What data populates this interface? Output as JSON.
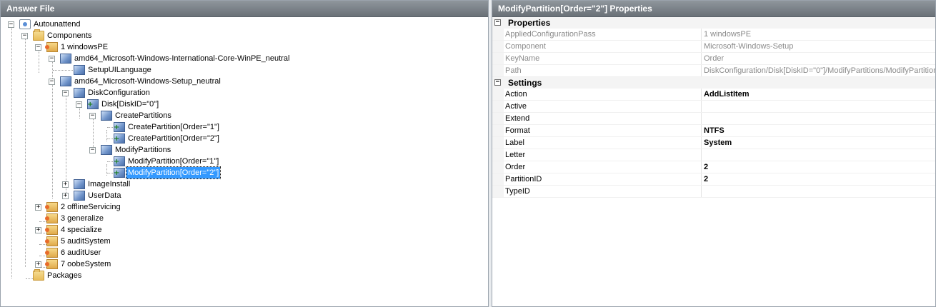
{
  "left_pane": {
    "title": "Answer File"
  },
  "right_pane": {
    "title": "ModifyPartition[Order=\"2\"] Properties"
  },
  "tree": {
    "root": "Autounattend",
    "components": "Components",
    "pass1": "1 windowsPE",
    "intl_component": "amd64_Microsoft-Windows-International-Core-WinPE_neutral",
    "setup_ui_language": "SetupUILanguage",
    "setup_component": "amd64_Microsoft-Windows-Setup_neutral",
    "disk_configuration": "DiskConfiguration",
    "disk": "Disk[DiskID=\"0\"]",
    "create_partitions": "CreatePartitions",
    "create_partition_1": "CreatePartition[Order=\"1\"]",
    "create_partition_2": "CreatePartition[Order=\"2\"]",
    "modify_partitions": "ModifyPartitions",
    "modify_partition_1": "ModifyPartition[Order=\"1\"]",
    "modify_partition_2": "ModifyPartition[Order=\"2\"]",
    "image_install": "ImageInstall",
    "user_data": "UserData",
    "pass2": "2 offlineServicing",
    "pass3": "3 generalize",
    "pass4": "4 specialize",
    "pass5": "5 auditSystem",
    "pass6": "6 auditUser",
    "pass7": "7 oobeSystem",
    "packages": "Packages"
  },
  "properties": {
    "category_properties": "Properties",
    "category_settings": "Settings",
    "readonly_rows": [
      {
        "name": "AppliedConfigurationPass",
        "value": "1 windowsPE"
      },
      {
        "name": "Component",
        "value": "Microsoft-Windows-Setup"
      },
      {
        "name": "KeyName",
        "value": "Order"
      },
      {
        "name": "Path",
        "value": "DiskConfiguration/Disk[DiskID=\"0\"]/ModifyPartitions/ModifyPartition"
      }
    ],
    "settings_rows": [
      {
        "name": "Action",
        "value": "AddListItem"
      },
      {
        "name": "Active",
        "value": ""
      },
      {
        "name": "Extend",
        "value": ""
      },
      {
        "name": "Format",
        "value": "NTFS"
      },
      {
        "name": "Label",
        "value": "System"
      },
      {
        "name": "Letter",
        "value": ""
      },
      {
        "name": "Order",
        "value": "2"
      },
      {
        "name": "PartitionID",
        "value": "2"
      },
      {
        "name": "TypeID",
        "value": ""
      }
    ]
  },
  "colors": {
    "selection": "#3399ff",
    "header": "#7c838a"
  }
}
